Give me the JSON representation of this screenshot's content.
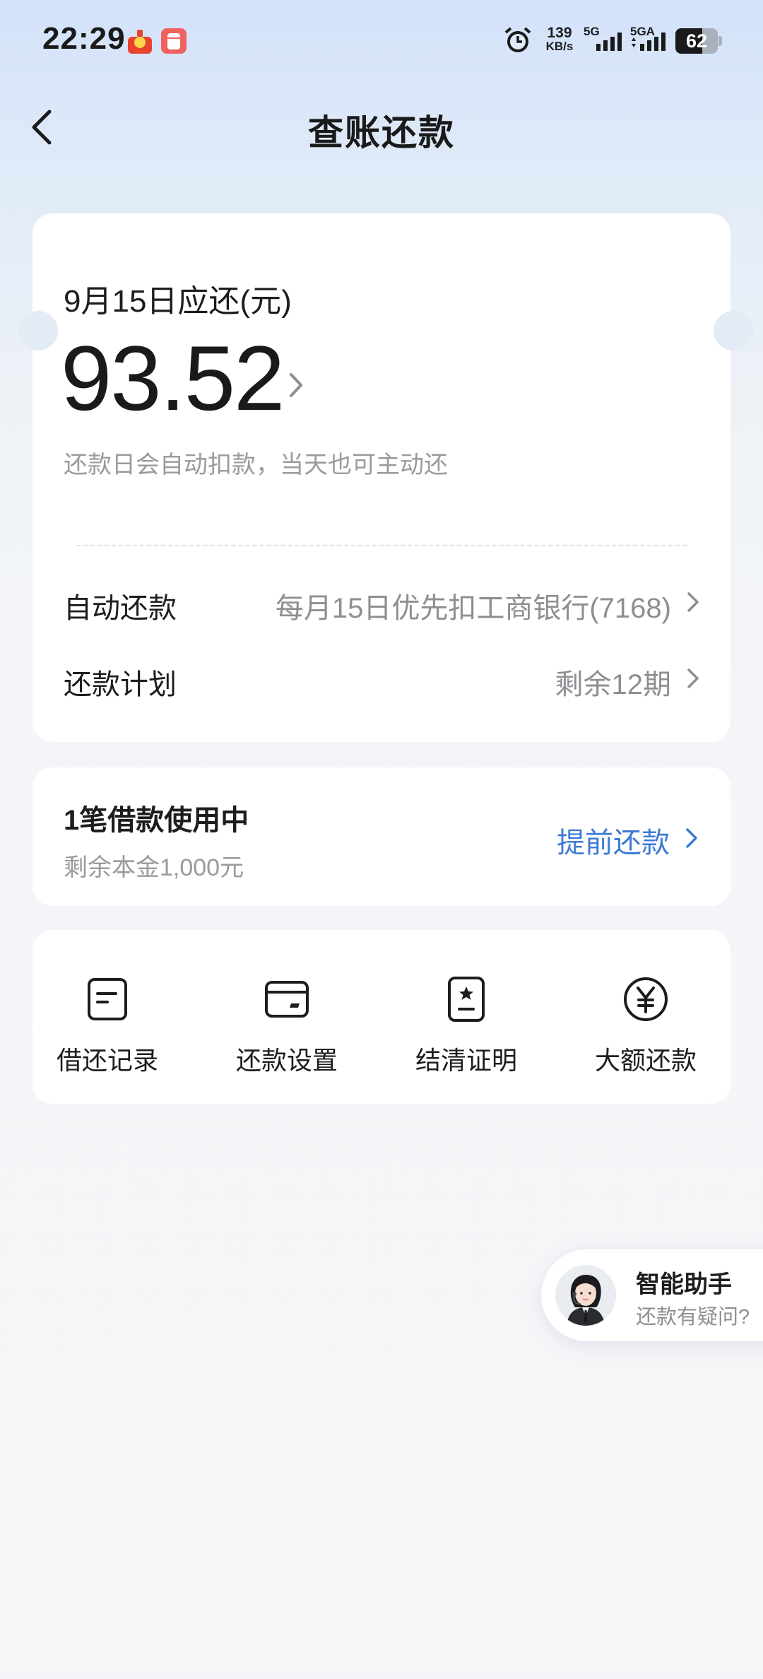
{
  "status_bar": {
    "time": "22:29",
    "net_speed": "139",
    "net_unit": "KB/s",
    "sim1": "5G",
    "sim2": "5GA",
    "battery": "62"
  },
  "header": {
    "title": "查账还款"
  },
  "due_card": {
    "label": "9月15日应还(元)",
    "amount": "93.52",
    "note": "还款日会自动扣款，当天也可主动还",
    "rows": [
      {
        "label": "自动还款",
        "value": "每月15日优先扣工商银行(7168)"
      },
      {
        "label": "还款计划",
        "value": "剩余12期"
      }
    ]
  },
  "loan_card": {
    "title": "1笔借款使用中",
    "subtitle": "剩余本金1,000元",
    "action": "提前还款"
  },
  "tools": [
    {
      "label": "借还记录",
      "icon": "record-icon"
    },
    {
      "label": "还款设置",
      "icon": "card-icon"
    },
    {
      "label": "结清证明",
      "icon": "certificate-icon"
    },
    {
      "label": "大额还款",
      "icon": "yuan-icon"
    }
  ],
  "assistant": {
    "title": "智能助手",
    "subtitle": "还款有疑问?"
  },
  "colors": {
    "accent": "#3d79d6",
    "secondary_text": "#9a9a9f",
    "background_top": "#d3e2fa"
  }
}
